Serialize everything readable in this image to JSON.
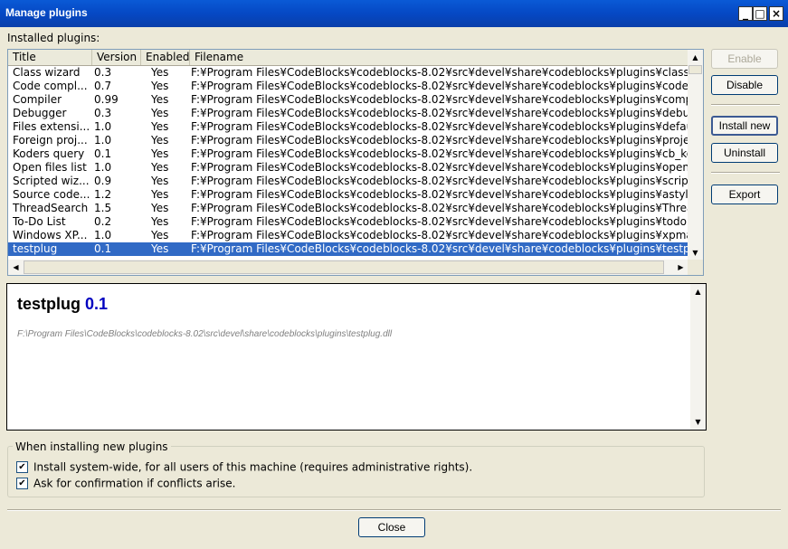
{
  "window": {
    "title": "Manage plugins",
    "minimize": "_",
    "maximize": "□",
    "close": "×"
  },
  "installed_label": "Installed plugins:",
  "columns": [
    "Title",
    "Version",
    "Enabled",
    "Filename"
  ],
  "plugins": [
    {
      "title": "Class wizard",
      "version": "0.3",
      "enabled": "Yes",
      "filename": "F:¥Program Files¥CodeBlocks¥codeblocks-8.02¥src¥devel¥share¥codeblocks¥plugins¥classwizard.dll"
    },
    {
      "title": "Code compl...",
      "version": "0.7",
      "enabled": "Yes",
      "filename": "F:¥Program Files¥CodeBlocks¥codeblocks-8.02¥src¥devel¥share¥codeblocks¥plugins¥codecompletion.dl"
    },
    {
      "title": "Compiler",
      "version": "0.99",
      "enabled": "Yes",
      "filename": "F:¥Program Files¥CodeBlocks¥codeblocks-8.02¥src¥devel¥share¥codeblocks¥plugins¥compiler.dll"
    },
    {
      "title": "Debugger",
      "version": "0.3",
      "enabled": "Yes",
      "filename": "F:¥Program Files¥CodeBlocks¥codeblocks-8.02¥src¥devel¥share¥codeblocks¥plugins¥debugger.dll"
    },
    {
      "title": "Files extensi...",
      "version": "1.0",
      "enabled": "Yes",
      "filename": "F:¥Program Files¥CodeBlocks¥codeblocks-8.02¥src¥devel¥share¥codeblocks¥plugins¥defaultmimehandl"
    },
    {
      "title": "Foreign proj...",
      "version": "1.0",
      "enabled": "Yes",
      "filename": "F:¥Program Files¥CodeBlocks¥codeblocks-8.02¥src¥devel¥share¥codeblocks¥plugins¥projectsimporter.d"
    },
    {
      "title": "Koders query",
      "version": "0.1",
      "enabled": "Yes",
      "filename": "F:¥Program Files¥CodeBlocks¥codeblocks-8.02¥src¥devel¥share¥codeblocks¥plugins¥cb_koders.dll"
    },
    {
      "title": "Open files list",
      "version": "1.0",
      "enabled": "Yes",
      "filename": "F:¥Program Files¥CodeBlocks¥codeblocks-8.02¥src¥devel¥share¥codeblocks¥plugins¥openfileslist.dll"
    },
    {
      "title": "Scripted wiz...",
      "version": "0.9",
      "enabled": "Yes",
      "filename": "F:¥Program Files¥CodeBlocks¥codeblocks-8.02¥src¥devel¥share¥codeblocks¥plugins¥scriptedwizard.dll"
    },
    {
      "title": "Source code...",
      "version": "1.2",
      "enabled": "Yes",
      "filename": "F:¥Program Files¥CodeBlocks¥codeblocks-8.02¥src¥devel¥share¥codeblocks¥plugins¥astyle.dll"
    },
    {
      "title": "ThreadSearch",
      "version": "1.5",
      "enabled": "Yes",
      "filename": "F:¥Program Files¥CodeBlocks¥codeblocks-8.02¥src¥devel¥share¥codeblocks¥plugins¥ThreadSearch.dll"
    },
    {
      "title": "To-Do List",
      "version": "0.2",
      "enabled": "Yes",
      "filename": "F:¥Program Files¥CodeBlocks¥codeblocks-8.02¥src¥devel¥share¥codeblocks¥plugins¥todo.dll"
    },
    {
      "title": "Windows XP...",
      "version": "1.0",
      "enabled": "Yes",
      "filename": "F:¥Program Files¥CodeBlocks¥codeblocks-8.02¥src¥devel¥share¥codeblocks¥plugins¥xpmanifest.dll"
    },
    {
      "title": "testplug",
      "version": "0.1",
      "enabled": "Yes",
      "filename": "F:¥Program Files¥CodeBlocks¥codeblocks-8.02¥src¥devel¥share¥codeblocks¥plugins¥testplug.dll",
      "selected": true
    }
  ],
  "detail": {
    "name": "testplug",
    "version": "0.1",
    "path": "F:\\Program Files\\CodeBlocks\\codeblocks-8.02\\src\\devel\\share\\codeblocks\\plugins\\testplug.dll"
  },
  "buttons": {
    "enable": "Enable",
    "disable": "Disable",
    "install_new": "Install new",
    "uninstall": "Uninstall",
    "export": "Export",
    "close": "Close"
  },
  "install_group": {
    "label": "When installing new plugins",
    "options": [
      {
        "label": "Install system-wide, for all users of this machine (requires administrative rights).",
        "checked": true
      },
      {
        "label": "Ask for confirmation if conflicts arise.",
        "checked": true
      }
    ]
  },
  "icons": {
    "check": "✔",
    "arrow_up": "▲",
    "arrow_down": "▼",
    "arrow_left": "◀",
    "arrow_right": "▶"
  },
  "colors": {
    "titlebar": "#0548c4",
    "selection": "#316ac5",
    "version_accent": "#0000c0"
  }
}
